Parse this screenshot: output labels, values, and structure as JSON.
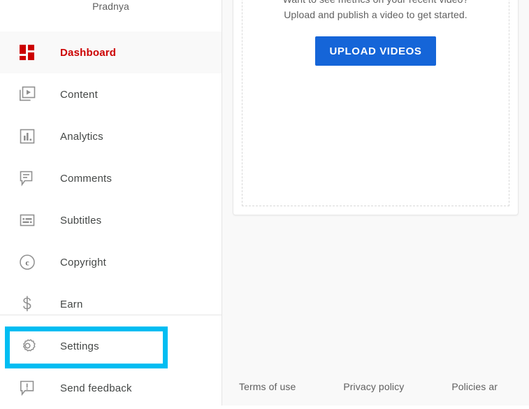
{
  "sidebar": {
    "channel_name": "Pradnya",
    "items": [
      {
        "label": "Dashboard",
        "icon": "dashboard-icon",
        "active": true
      },
      {
        "label": "Content",
        "icon": "content-icon",
        "active": false
      },
      {
        "label": "Analytics",
        "icon": "analytics-icon",
        "active": false
      },
      {
        "label": "Comments",
        "icon": "comments-icon",
        "active": false
      },
      {
        "label": "Subtitles",
        "icon": "subtitles-icon",
        "active": false
      },
      {
        "label": "Copyright",
        "icon": "copyright-icon",
        "active": false
      },
      {
        "label": "Earn",
        "icon": "dollar-icon",
        "active": false
      },
      {
        "label": "Settings",
        "icon": "gear-icon",
        "active": false
      },
      {
        "label": "Send feedback",
        "icon": "feedback-icon",
        "active": false
      }
    ],
    "highlighted_item": "Settings",
    "highlight_color": "#00bdf2",
    "active_color": "#cc0000"
  },
  "main": {
    "empty_state": {
      "line1": "Want to see metrics on your recent video?",
      "line2": "Upload and publish a video to get started.",
      "upload_button": "UPLOAD VIDEOS",
      "button_color": "#1565d8"
    }
  },
  "footer": {
    "links": [
      {
        "label": "Terms of use"
      },
      {
        "label": "Privacy policy"
      },
      {
        "label": "Policies ar"
      }
    ]
  }
}
